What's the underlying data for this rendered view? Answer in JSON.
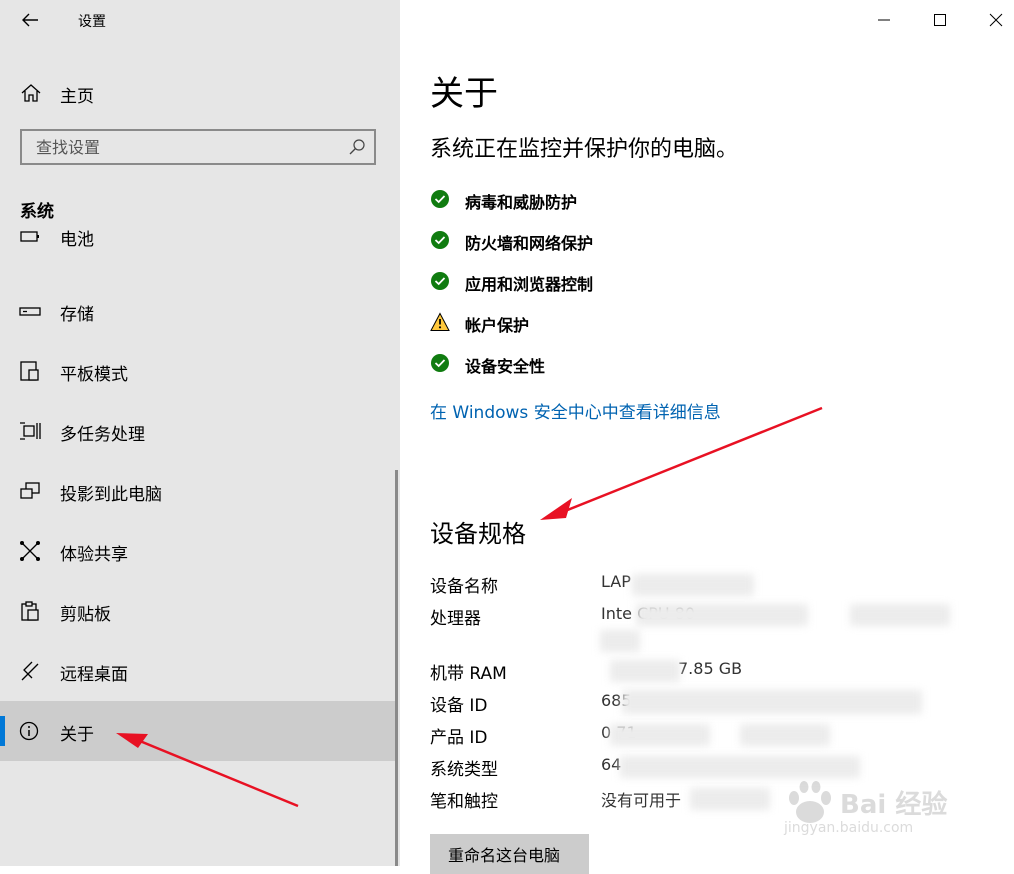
{
  "window": {
    "title": "设置"
  },
  "sidebar": {
    "home_label": "主页",
    "search_placeholder": "查找设置",
    "section_heading": "系统",
    "items": [
      {
        "label": "电池",
        "icon": "battery-icon"
      },
      {
        "label": "存储",
        "icon": "storage-icon"
      },
      {
        "label": "平板模式",
        "icon": "tablet-mode-icon"
      },
      {
        "label": "多任务处理",
        "icon": "multitasking-icon"
      },
      {
        "label": "投影到此电脑",
        "icon": "project-icon"
      },
      {
        "label": "体验共享",
        "icon": "share-icon"
      },
      {
        "label": "剪贴板",
        "icon": "clipboard-icon"
      },
      {
        "label": "远程桌面",
        "icon": "remote-desktop-icon"
      },
      {
        "label": "关于",
        "icon": "info-icon",
        "selected": true
      }
    ]
  },
  "main": {
    "title": "关于",
    "protection_subtitle": "系统正在监控并保护你的电脑。",
    "status_items": [
      {
        "label": "病毒和威胁防护",
        "status": "ok"
      },
      {
        "label": "防火墙和网络保护",
        "status": "ok"
      },
      {
        "label": "应用和浏览器控制",
        "status": "ok"
      },
      {
        "label": "帐户保护",
        "status": "warning"
      },
      {
        "label": "设备安全性",
        "status": "ok"
      }
    ],
    "security_link": "在 Windows 安全中心中查看详细信息",
    "specs_title": "设备规格",
    "specs": [
      {
        "key": "设备名称",
        "value": "LAP"
      },
      {
        "key": "处理器",
        "value": "Inte                                 CPU                   80"
      },
      {
        "key": "机带 RAM",
        "value": "7.85 GB"
      },
      {
        "key": "设备 ID",
        "value": "685"
      },
      {
        "key": "产品 ID",
        "value": "0                   71"
      },
      {
        "key": "系统类型",
        "value": "64"
      },
      {
        "key": "笔和触控",
        "value": "没有可用于"
      }
    ],
    "rename_button": "重命名这台电脑"
  },
  "watermark": {
    "text": "Bai 经验",
    "sub": "jingyan.baidu.com"
  },
  "colors": {
    "accent": "#0078d7",
    "link": "#0063b1",
    "ok": "#107c10",
    "warning": "#ffc83d",
    "annotation": "#e81123"
  }
}
